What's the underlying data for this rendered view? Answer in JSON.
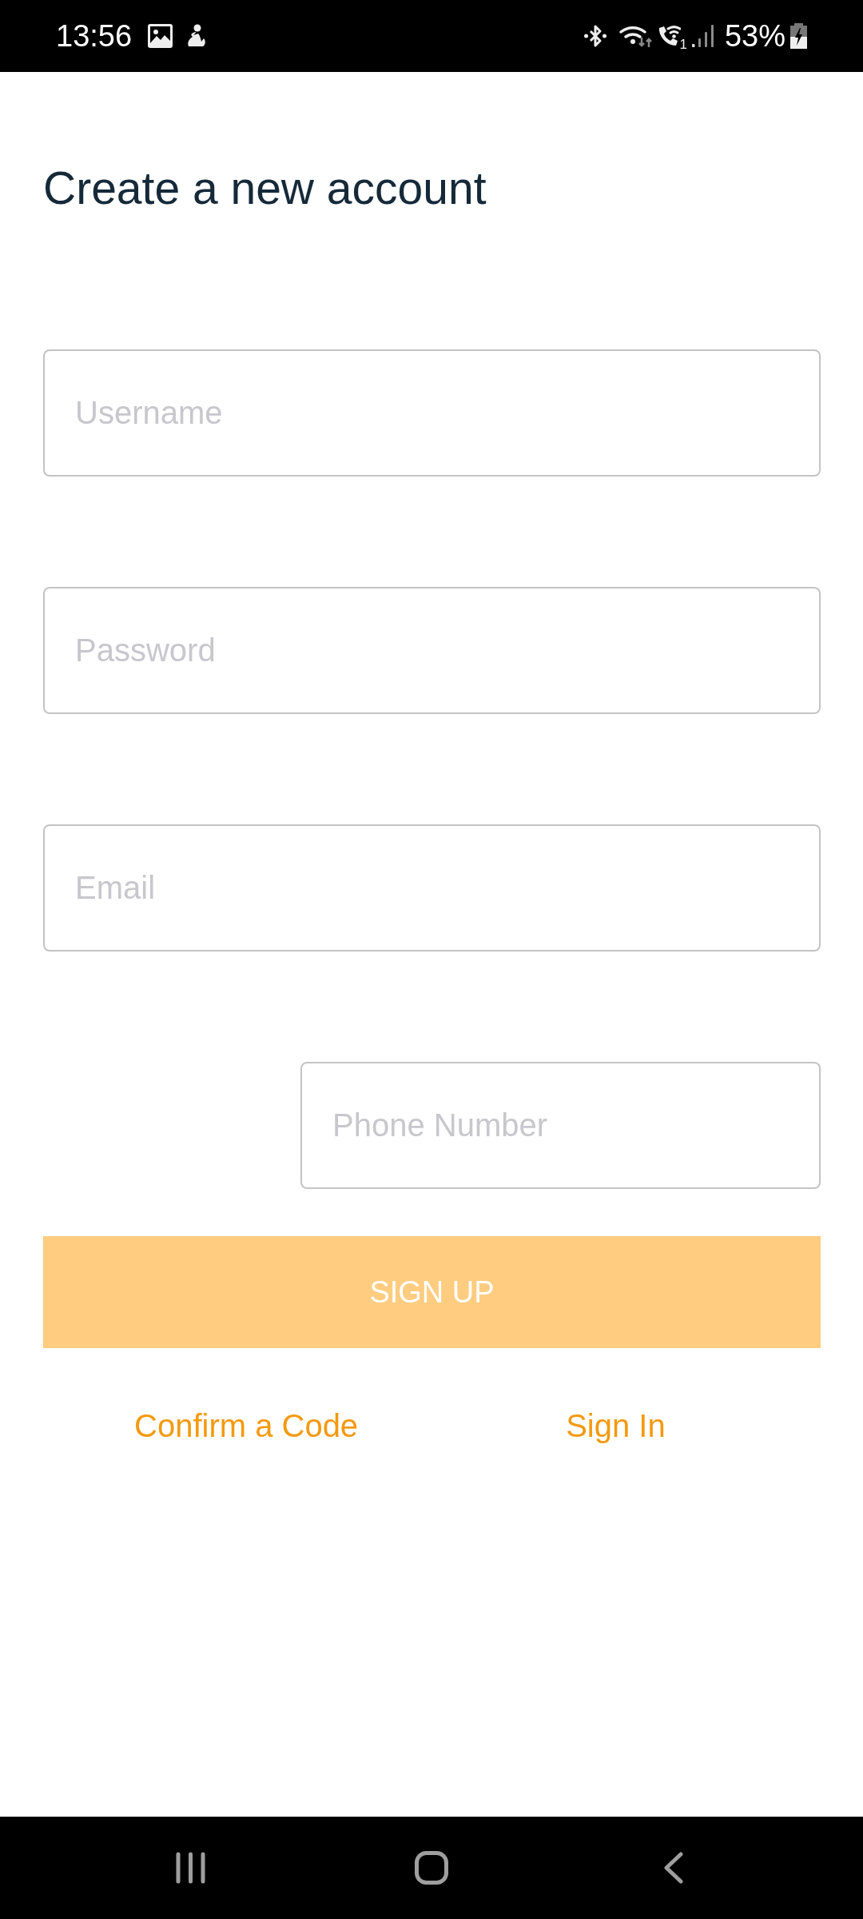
{
  "status_bar": {
    "time": "13:56",
    "sim_slot": "1",
    "battery": "53%"
  },
  "title": "Create a new account",
  "fields": [
    {
      "kind": "username",
      "placeholder": "Username"
    },
    {
      "kind": "password",
      "placeholder": "Password"
    },
    {
      "kind": "email",
      "placeholder": "Email"
    },
    {
      "kind": "phone",
      "placeholder": "Phone Number"
    }
  ],
  "sign_up_button": {
    "label": "SIGN UP",
    "disabled": true
  },
  "links": [
    {
      "label": "Confirm a Code"
    },
    {
      "label": "Sign In"
    }
  ]
}
